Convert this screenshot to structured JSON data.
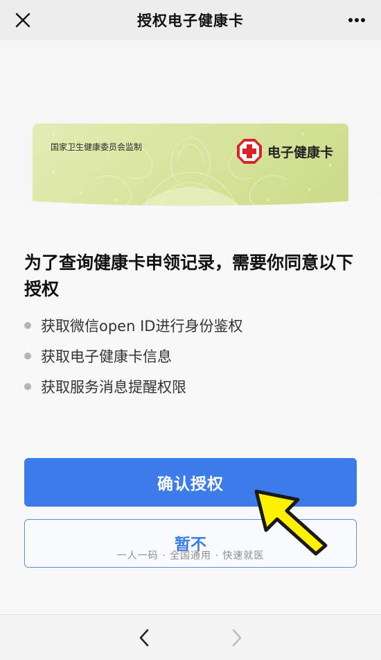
{
  "header": {
    "title": "授权电子健康卡",
    "close_icon": "close-icon",
    "more_icon": "more-icon"
  },
  "card": {
    "issuer": "国家卫生健康委员会监制",
    "brand": "电子健康卡",
    "logo_icon": "red-cross-icon",
    "colors": {
      "card": "#d6e39a",
      "logo": "#d8232a"
    }
  },
  "main": {
    "heading": "为了查询健康卡申领记录，需要你同意以下授权",
    "permissions": [
      "获取微信open ID进行身份鉴权",
      "获取电子健康卡信息",
      "获取服务消息提醒权限"
    ]
  },
  "actions": {
    "confirm_label": "确认授权",
    "later_label": "暂不",
    "slogan": "一人一码 · 全国通用 · 快速就医",
    "accent_color": "#3b7bea"
  },
  "annotation": {
    "pointer_icon": "yellow-arrow-pointer-icon"
  },
  "bottom_nav": {
    "back_icon": "chevron-left-icon",
    "forward_icon": "chevron-right-icon"
  }
}
